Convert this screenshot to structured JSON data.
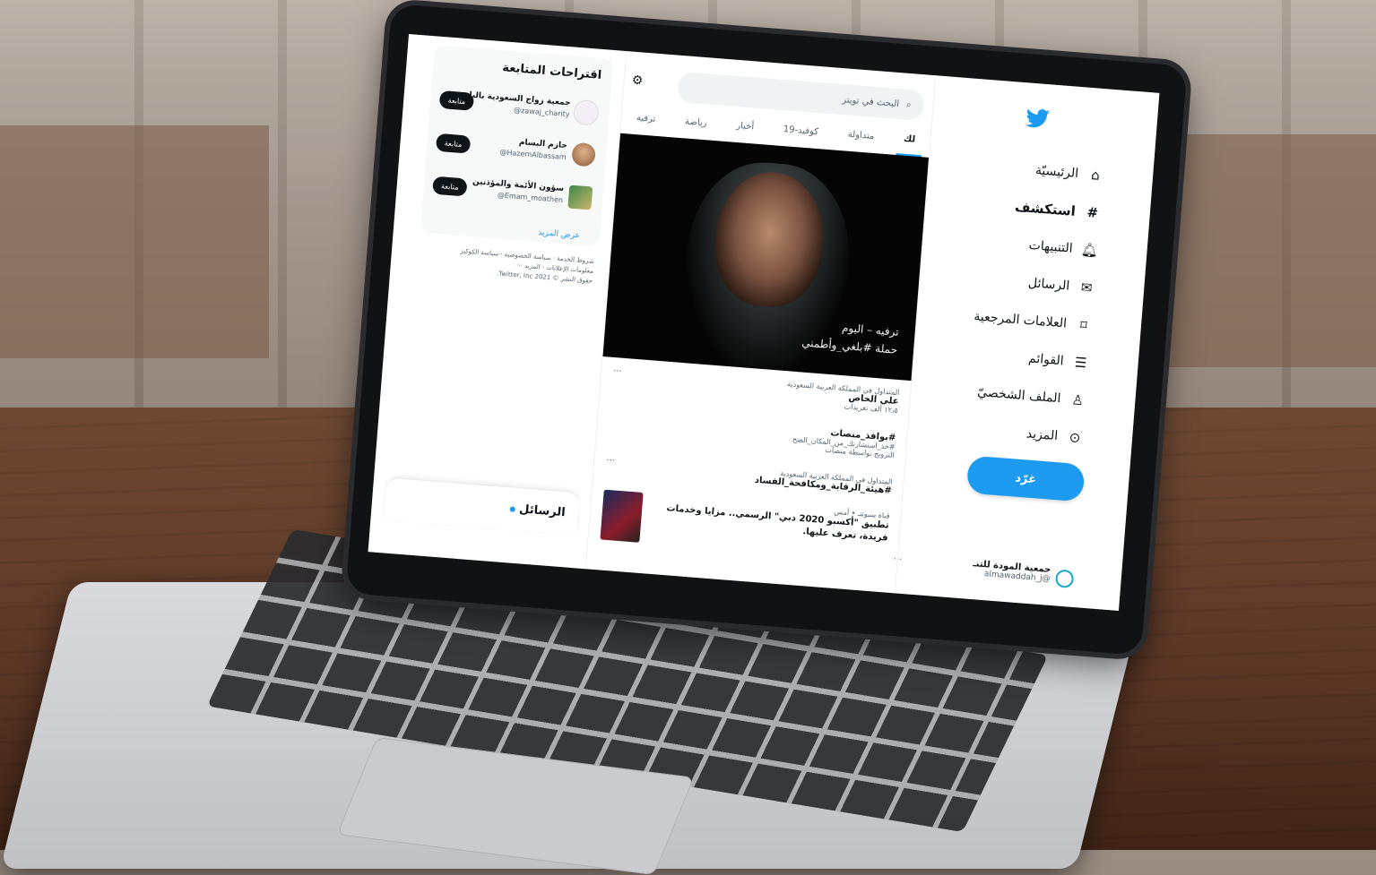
{
  "nav": {
    "items": [
      {
        "label": "الرئيسيّة",
        "icon": "home-icon"
      },
      {
        "label": "استكشف",
        "icon": "hashtag-icon"
      },
      {
        "label": "التنبيهات",
        "icon": "bell-icon"
      },
      {
        "label": "الرسائل",
        "icon": "mail-icon"
      },
      {
        "label": "العلامات المرجعية",
        "icon": "bookmark-icon"
      },
      {
        "label": "القوائم",
        "icon": "list-icon"
      },
      {
        "label": "الملف الشخصيّ",
        "icon": "profile-icon"
      },
      {
        "label": "المزيد",
        "icon": "more-icon"
      }
    ],
    "tweet_button": "غرّد",
    "profile": {
      "name": "جمعية المودة للتنـ",
      "handle": "@almawaddah_j"
    }
  },
  "search": {
    "placeholder": "البحث في تويتر"
  },
  "tabs": [
    "لك",
    "متداولة",
    "كوفيد-19",
    "أخبار",
    "رياضة",
    "ترفيه"
  ],
  "hero": {
    "caption_line1": "ترفيه – اليوم",
    "caption_line2": "حملة #بلغي_وأطمني"
  },
  "trends": [
    {
      "context": "المتداول في المملكة العربية السعودية",
      "title": "علي الحاص",
      "sub": "١٢٫٥ ألف تغريدات"
    },
    {
      "context": "",
      "title": "#بوافذ_منصات",
      "sub": "#خذ_استشارتك_من_المكان_الصح",
      "promo": "الترويج بواسطة منصات"
    },
    {
      "context": "المتداول في المملكة العربية السعودية",
      "title": "#هيئة_الرقابة_ومكافحة_الفساد",
      "sub": ""
    }
  ],
  "news": {
    "source": "قناة سبوتنـ • أمس",
    "headline": "تطبيق \"أكسبو 2020 دبي\" الرسمي.. مزايا وخدمات فريدة، تعرف عليها."
  },
  "suggestions": {
    "title": "اقتراحات المتابعة",
    "people": [
      {
        "name": "جمعية زواج السعودية بالبا",
        "handle": "@zawaj_charity",
        "button": "متابعة"
      },
      {
        "name": "حازم البسام",
        "handle": "@HazemAlbassam",
        "button": "متابعة"
      },
      {
        "name": "سؤون الأئمة والمؤذنين",
        "handle": "@Emam_moathen",
        "button": "متابعة"
      }
    ],
    "show_more": "عرض المزيد"
  },
  "footer": {
    "line1": "شروط الخدمة · سياسة الخصوصية · سياسة الكوكيز",
    "line2": "معلومات الإعلانات · المزيد ···",
    "line3": "حقوق النشر © 2021 Twitter, Inc."
  },
  "messages_bar": {
    "label": "الرسائل"
  },
  "colors": {
    "accent": "#1d9bf0",
    "text": "#0f1419",
    "muted": "#536471"
  }
}
